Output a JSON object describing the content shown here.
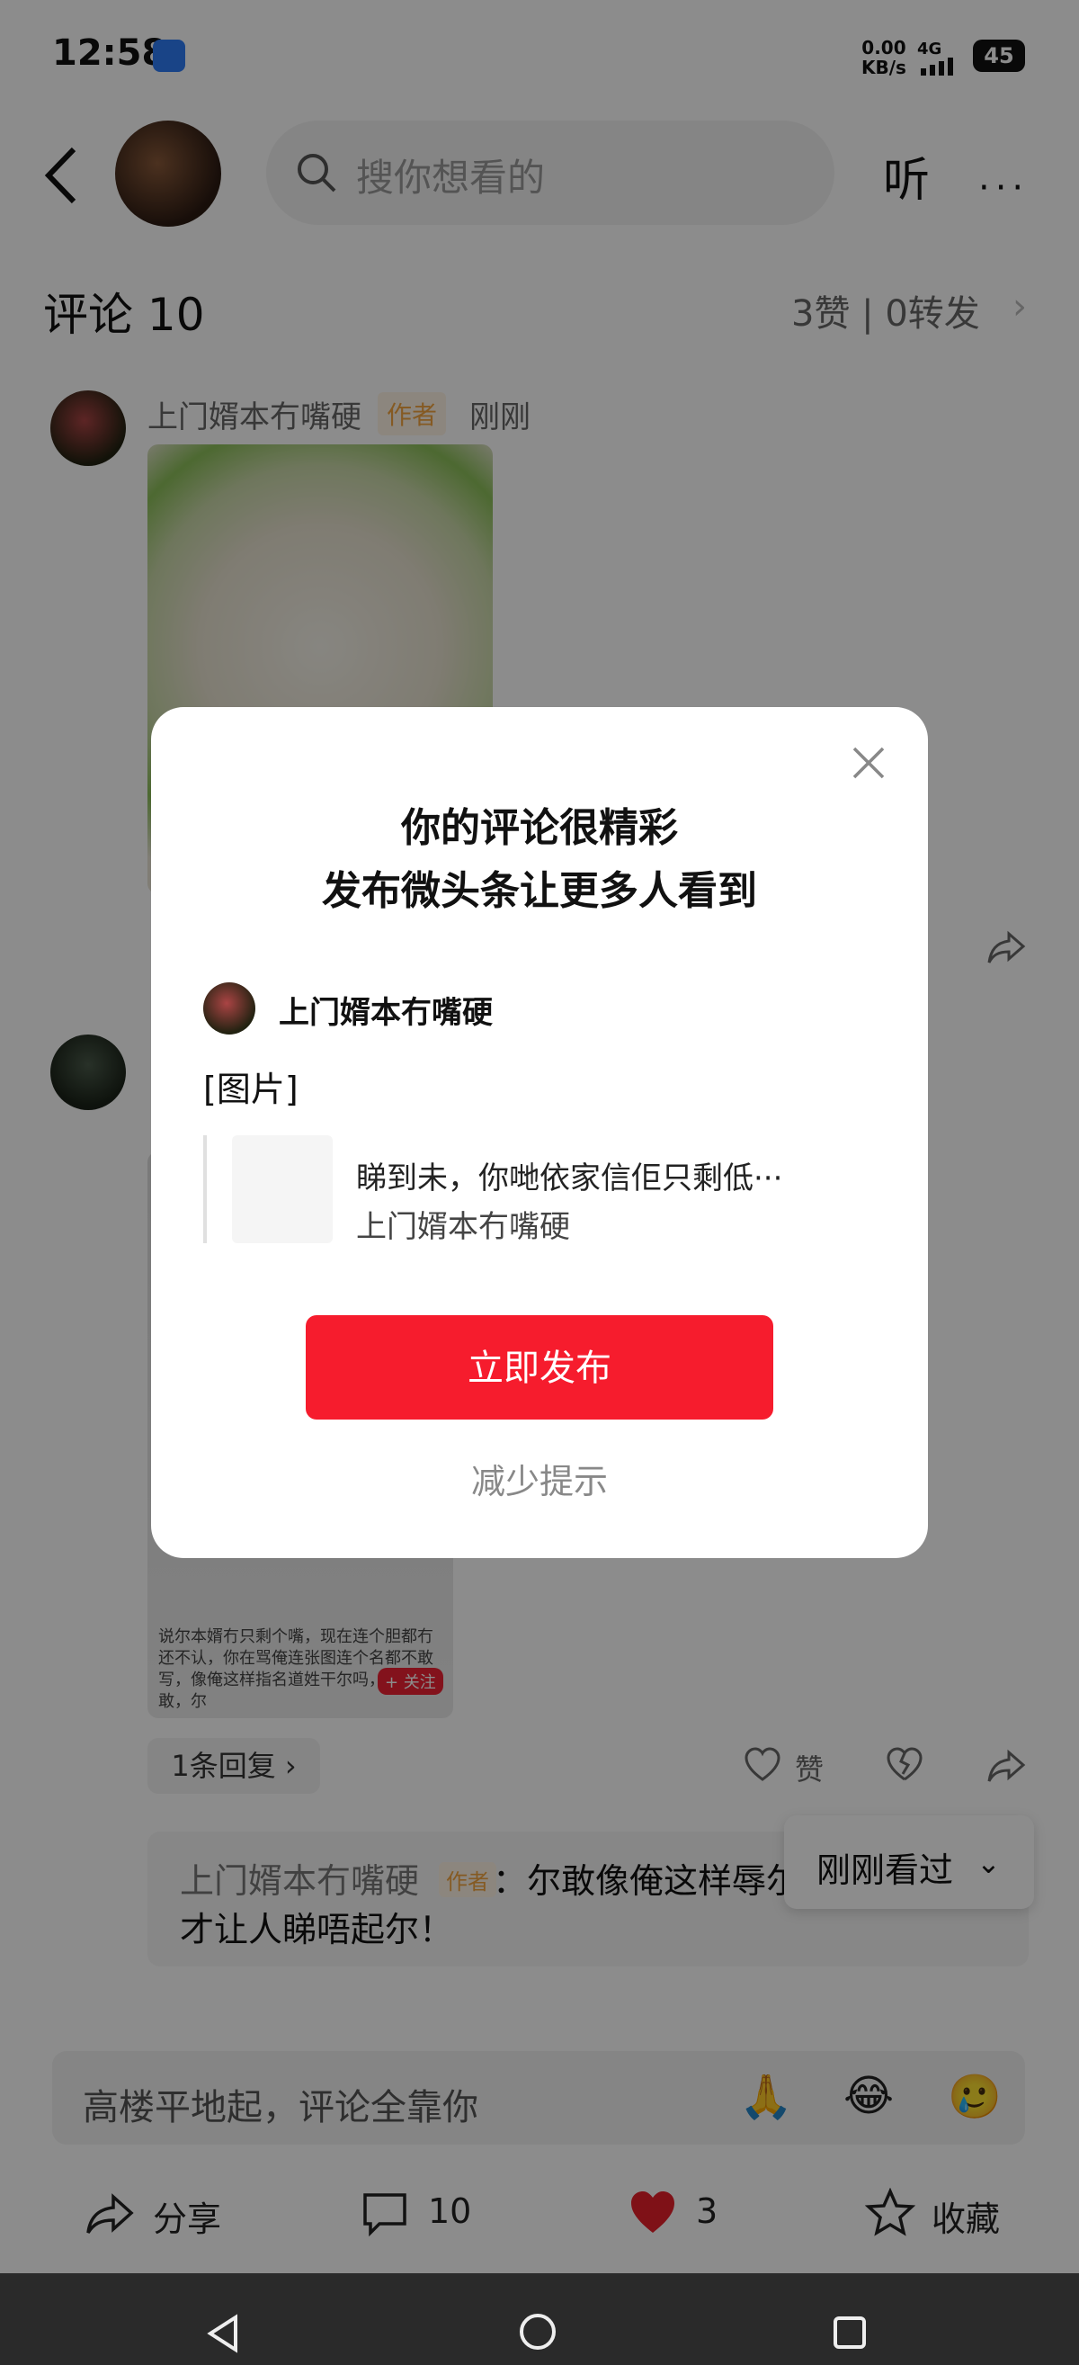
{
  "status_bar": {
    "time": "12:58",
    "net_speed": "0.00",
    "net_unit": "KB/s",
    "signal": "4G",
    "battery": "45"
  },
  "header": {
    "search_placeholder": "搜你想看的",
    "listen_label": "听",
    "more_label": "···"
  },
  "comments": {
    "title": "评论 10",
    "stats": "3赞 | 0转发",
    "first": {
      "name": "上门婿本冇嘴硬",
      "author_badge": "作者",
      "time": "刚刚"
    },
    "second": {
      "screenshot_text": "说尔本婿冇只剩个嘴，现在连个胆都冇还不认，你在骂俺连张图连个名都不敢写，像俺这样指名道姓干尔吗，尔瞎敢，尔",
      "screenshot_badge": "+ 关注",
      "reply_count": "1条回复 ›",
      "like_label": "赞"
    },
    "reply": {
      "name": "上门婿本冇嘴硬",
      "author_badge": "作者",
      "text_line1": "：尔敢像俺这样辱尔",
      "text_line2": "才让人睇唔起尔！"
    },
    "recent_chip": "刚刚看过"
  },
  "input_bar": {
    "placeholder": "高楼平地起，评论全靠你",
    "emojis": [
      "🙏",
      "😂",
      "🥲"
    ]
  },
  "actions": {
    "share": "分享",
    "comment_count": "10",
    "like_count": "3",
    "favorite": "收藏"
  },
  "dialog": {
    "title_line1": "你的评论很精彩",
    "title_line2": "发布微头条让更多人看到",
    "user_name": "上门婿本冇嘴硬",
    "content_label": "[图片]",
    "quote_text": "睇到未，你哋依家信佢只剩低···",
    "quote_author": "上门婿本冇嘴硬",
    "publish_button": "立即发布",
    "reduce_label": "减少提示"
  },
  "colors": {
    "accent_red": "#f61c2d",
    "author_badge": "#f2a541"
  }
}
